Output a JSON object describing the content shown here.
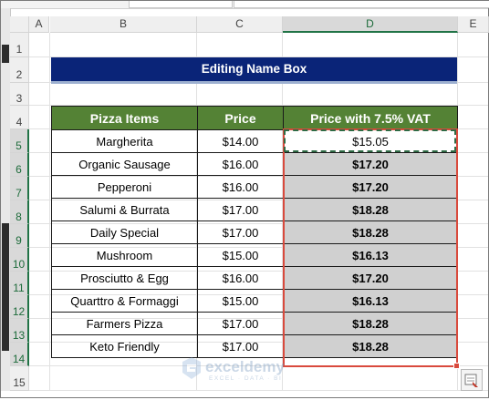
{
  "columns": [
    "A",
    "B",
    "C",
    "D",
    "E"
  ],
  "rows": [
    "1",
    "2",
    "3",
    "4",
    "5",
    "6",
    "7",
    "8",
    "9",
    "10",
    "11",
    "12",
    "13",
    "14",
    "15"
  ],
  "title": "Editing Name Box",
  "headers": {
    "item": "Pizza Items",
    "price": "Price",
    "vat": "Price with 7.5% VAT"
  },
  "items": [
    {
      "item": "Margherita",
      "price": "$14.00",
      "vat": "$15.05"
    },
    {
      "item": "Organic Sausage",
      "price": "$16.00",
      "vat": "$17.20"
    },
    {
      "item": "Pepperoni",
      "price": "$16.00",
      "vat": "$17.20"
    },
    {
      "item": "Salumi & Burrata",
      "price": "$17.00",
      "vat": "$18.28"
    },
    {
      "item": "Daily Special",
      "price": "$17.00",
      "vat": "$18.28"
    },
    {
      "item": "Mushroom",
      "price": "$15.00",
      "vat": "$16.13"
    },
    {
      "item": "Prosciutto & Egg",
      "price": "$16.00",
      "vat": "$17.20"
    },
    {
      "item": "Quarttro & Formaggi",
      "price": "$15.00",
      "vat": "$16.13"
    },
    {
      "item": "Farmers Pizza",
      "price": "$17.00",
      "vat": "$18.28"
    },
    {
      "item": "Keto Friendly",
      "price": "$17.00",
      "vat": "$18.28"
    }
  ],
  "watermark": {
    "name": "exceldemy",
    "tagline": "EXCEL · DATA · BI"
  },
  "colors": {
    "title_bg": "#0a2478",
    "header_bg": "#548235",
    "selection": "#d94a3d",
    "selected_fill": "#d0d0d0"
  }
}
